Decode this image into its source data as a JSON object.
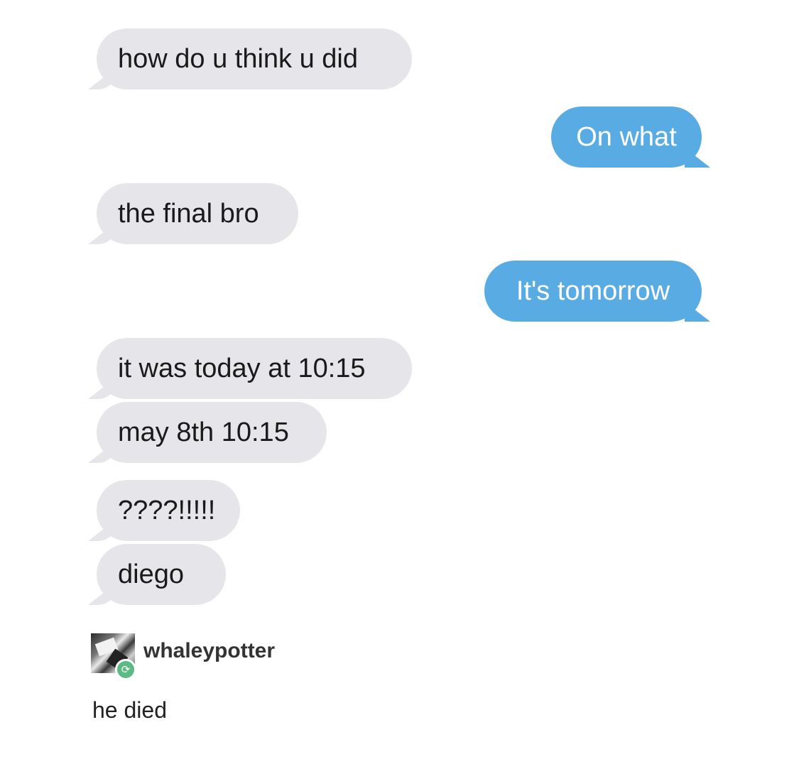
{
  "conversation": {
    "messages": [
      {
        "sender": "other",
        "text": "how do u think u did"
      },
      {
        "sender": "me",
        "text": "On what"
      },
      {
        "sender": "other",
        "text": "the final bro"
      },
      {
        "sender": "me",
        "text": "It's tomorrow"
      },
      {
        "sender": "other",
        "text": "it was today at 10:15"
      },
      {
        "sender": "other",
        "text": "may 8th 10:15"
      },
      {
        "sender": "other",
        "text": "????!!!!!"
      },
      {
        "sender": "other",
        "text": "diego"
      }
    ],
    "colors": {
      "incoming_bubble": "#e6e5ea",
      "outgoing_bubble": "#59abe3",
      "incoming_text": "#1a1a1a",
      "outgoing_text": "#ffffff"
    }
  },
  "post": {
    "username": "whaleypotter",
    "avatar_icon": "user-avatar-icon",
    "badge_icon": "reblog-icon",
    "badge_glyph": "⟳",
    "badge_color": "#5cba84",
    "caption": "he died"
  }
}
